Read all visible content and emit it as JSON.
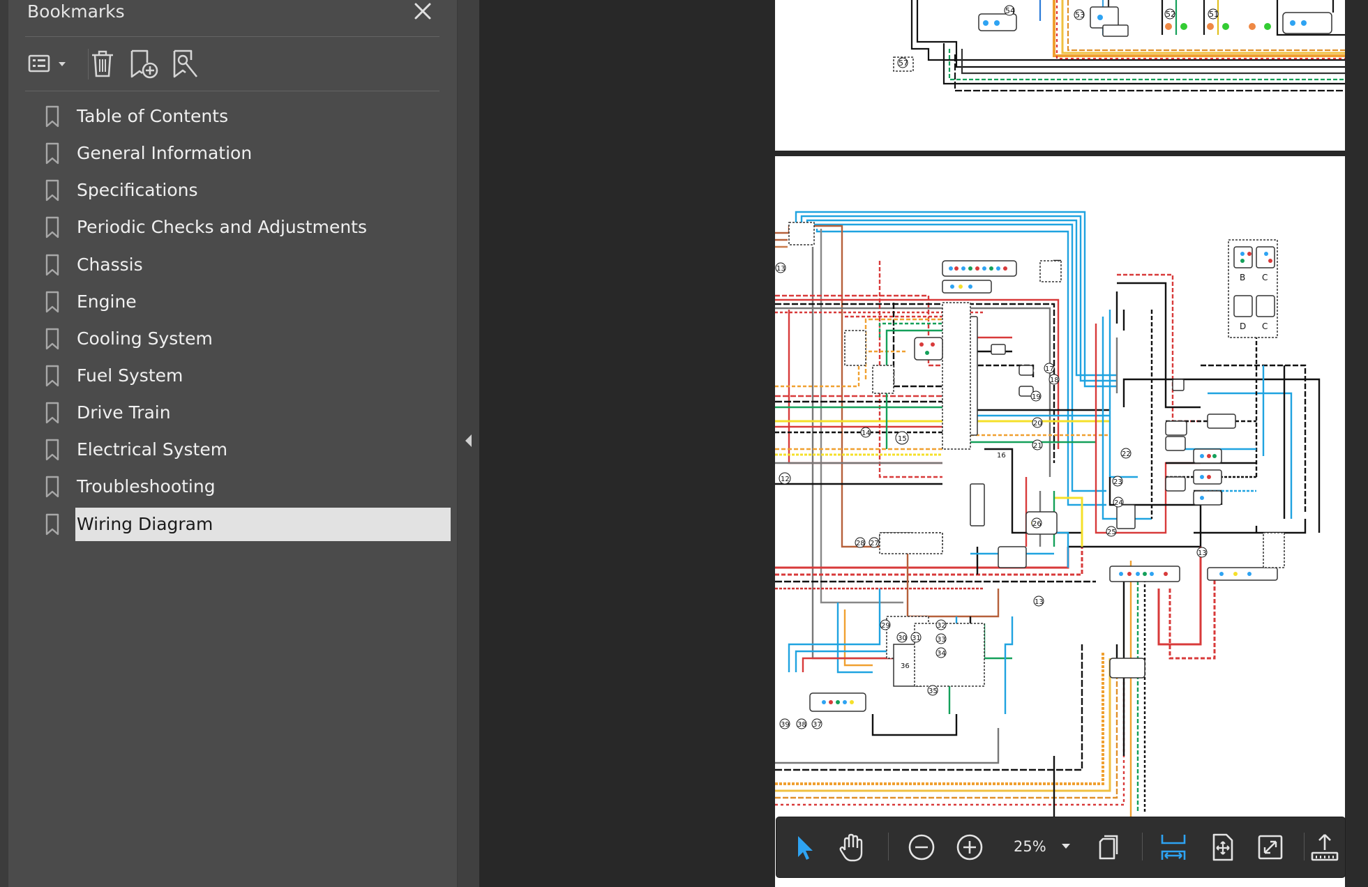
{
  "bookmarks_panel": {
    "title": "Bookmarks",
    "items": [
      {
        "label": "Table of Contents"
      },
      {
        "label": "General Information"
      },
      {
        "label": "Specifications"
      },
      {
        "label": "Periodic Checks and Adjustments"
      },
      {
        "label": "Chassis"
      },
      {
        "label": "Engine"
      },
      {
        "label": "Cooling System"
      },
      {
        "label": "Fuel System"
      },
      {
        "label": "Drive Train"
      },
      {
        "label": "Electrical System"
      },
      {
        "label": "Troubleshooting"
      },
      {
        "label": "Wiring Diagram"
      }
    ],
    "selected": "Wiring Diagram"
  },
  "toolbar": {
    "zoom": "25%",
    "accent_color": "#2ea3f2"
  },
  "diagram": {
    "top_labels": [
      "54",
      "53",
      "52",
      "51",
      "57"
    ],
    "main_labels": [
      "13",
      "14",
      "15",
      "16",
      "17",
      "18",
      "19",
      "20",
      "21",
      "22",
      "23",
      "24",
      "25",
      "26",
      "27",
      "28",
      "12",
      "13",
      "13",
      "29",
      "30",
      "31",
      "32",
      "33",
      "34",
      "35",
      "36",
      "37",
      "38",
      "39"
    ],
    "connector_letters": [
      "B",
      "C",
      "D",
      "C"
    ]
  }
}
